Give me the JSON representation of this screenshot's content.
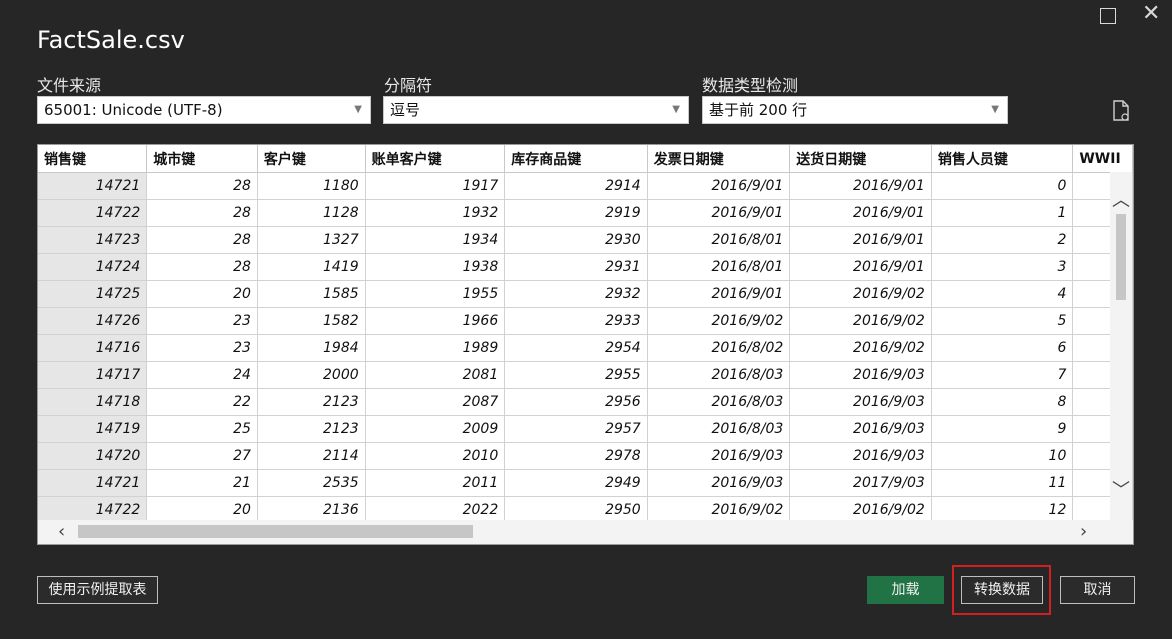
{
  "window": {
    "title": "FactSale.csv"
  },
  "options": {
    "file_origin": {
      "label": "文件来源",
      "value": "65001: Unicode (UTF-8)"
    },
    "delimiter": {
      "label": "分隔符",
      "value": "逗号"
    },
    "type_detection": {
      "label": "数据类型检测",
      "value": "基于前 200 行"
    }
  },
  "table": {
    "columns": [
      "销售键",
      "城市键",
      "客户键",
      "账单客户键",
      "库存商品键",
      "发票日期键",
      "送货日期键",
      "销售人员键",
      "WWII"
    ],
    "rows": [
      [
        "14721",
        "28",
        "1180",
        "1917",
        "2914",
        "2016/9/01",
        "2016/9/01",
        "0",
        ""
      ],
      [
        "14722",
        "28",
        "1128",
        "1932",
        "2919",
        "2016/9/01",
        "2016/9/01",
        "1",
        ""
      ],
      [
        "14723",
        "28",
        "1327",
        "1934",
        "2930",
        "2016/8/01",
        "2016/9/01",
        "2",
        ""
      ],
      [
        "14724",
        "28",
        "1419",
        "1938",
        "2931",
        "2016/8/01",
        "2016/9/01",
        "3",
        ""
      ],
      [
        "14725",
        "20",
        "1585",
        "1955",
        "2932",
        "2016/9/01",
        "2016/9/02",
        "4",
        ""
      ],
      [
        "14726",
        "23",
        "1582",
        "1966",
        "2933",
        "2016/9/02",
        "2016/9/02",
        "5",
        ""
      ],
      [
        "14716",
        "23",
        "1984",
        "1989",
        "2954",
        "2016/8/02",
        "2016/9/02",
        "6",
        ""
      ],
      [
        "14717",
        "24",
        "2000",
        "2081",
        "2955",
        "2016/8/03",
        "2016/9/03",
        "7",
        ""
      ],
      [
        "14718",
        "22",
        "2123",
        "2087",
        "2956",
        "2016/8/03",
        "2016/9/03",
        "8",
        ""
      ],
      [
        "14719",
        "25",
        "2123",
        "2009",
        "2957",
        "2016/8/03",
        "2016/9/03",
        "9",
        ""
      ],
      [
        "14720",
        "27",
        "2114",
        "2010",
        "2978",
        "2016/9/03",
        "2016/9/03",
        "10",
        ""
      ],
      [
        "14721",
        "21",
        "2535",
        "2011",
        "2949",
        "2016/9/03",
        "2017/9/03",
        "11",
        ""
      ],
      [
        "14722",
        "20",
        "2136",
        "2022",
        "2950",
        "2016/9/02",
        "2016/9/02",
        "12",
        ""
      ]
    ]
  },
  "buttons": {
    "extract_example": "使用示例提取表",
    "load": "加载",
    "transform": "转换数据",
    "cancel": "取消"
  },
  "icons": [
    "maximize-icon",
    "close-icon",
    "file-settings-icon",
    "chevron-up-icon",
    "chevron-down-icon",
    "chevron-left-icon",
    "chevron-right-icon"
  ],
  "colors": {
    "load_button": "#217346",
    "highlight_box": "#d02020",
    "background": "#262626"
  }
}
